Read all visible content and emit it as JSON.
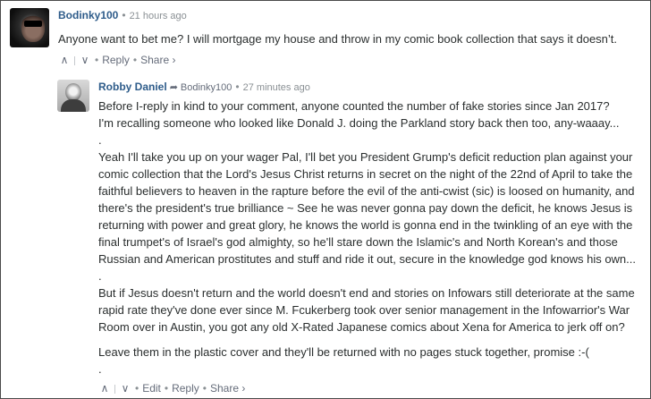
{
  "comments": [
    {
      "author": "Bodinky100",
      "time": "21 hours ago",
      "body": [
        "Anyone want to bet me? I will mortgage my house and throw in my comic book collection that says it doesn’t."
      ],
      "footer": {
        "upvote": "∧",
        "downvote": "∨",
        "reply": "Reply",
        "share": "Share ›"
      }
    },
    {
      "author": "Robby Daniel",
      "reply_to": "Bodinky100",
      "time": "27 minutes ago",
      "body": [
        "Before I-reply in kind to your comment, anyone counted the number of fake stories since Jan 2017?",
        "I'm recalling someone who looked like Donald J. doing the Parkland story back then too, any-waaay...",
        ".",
        "Yeah I'll take you up on your wager Pal, I'll bet you President Grump's deficit reduction plan against your",
        "comic collection that the Lord's Jesus Christ returns in secret on the night of the 22nd of April to take the",
        "faithful believers to heaven in the rapture before the evil of the anti-cwist (sic) is loosed on humanity, and",
        "there's the president's true brilliance ~ See he was never gonna pay down the deficit, he knows Jesus is",
        "returning with power and great glory, he knows the world is gonna end in the twinkling of an eye with the",
        "final trumpet's of Israel's god almighty, so he'll stare down the Islamic's and North Korean's and those",
        "Russian and American prostitutes and stuff and ride it out, secure in the knowledge god knows his own...",
        ".",
        "But if Jesus doesn't return and the world doesn't end and stories on Infowars still deteriorate at the same",
        "rapid rate they've done ever since M. Fcukerberg took over senior management in the Infowarrior's War",
        "Room over in Austin, you got any old X-Rated Japanese comics about Xena for America to jerk off on?",
        "Leave them in the plastic cover and they'll be returned with no pages stuck together, promise :-(",
        "."
      ],
      "footer": {
        "upvote": "∧",
        "downvote": "∨",
        "edit": "Edit",
        "reply": "Reply",
        "share": "Share ›"
      }
    }
  ],
  "colors": {
    "author": "#2e5c8a",
    "meta": "#8a9094",
    "text": "#2a2e2e",
    "frame": "#4a4a4a"
  }
}
